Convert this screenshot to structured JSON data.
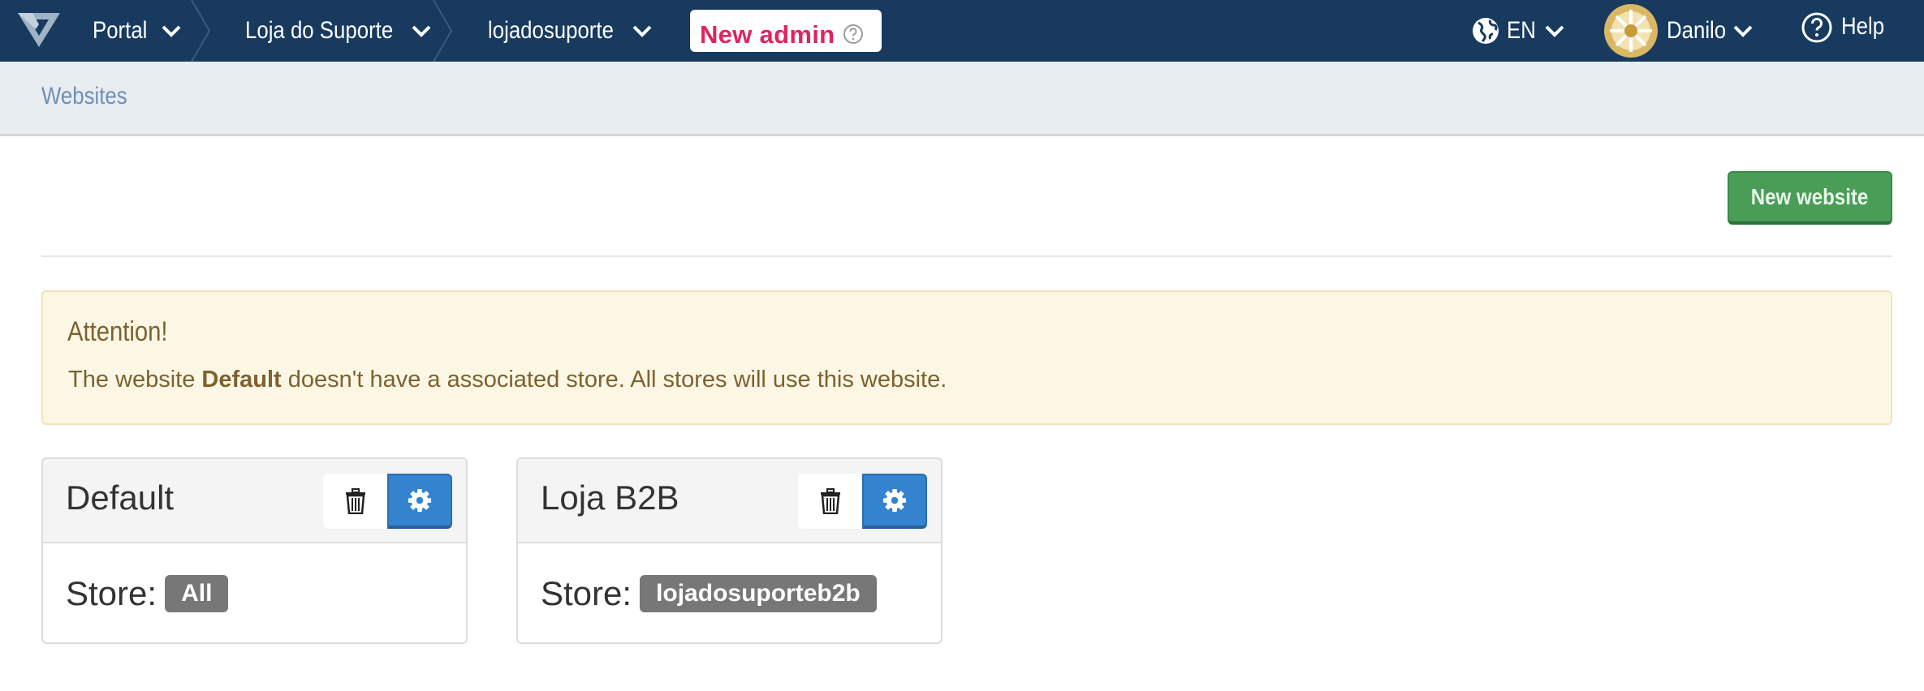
{
  "navbar": {
    "portal": "Portal",
    "store": "Loja do Suporte",
    "account": "lojadosuporte",
    "new_admin": "New admin",
    "language": "EN",
    "user": "Danilo",
    "help": "Help"
  },
  "breadcrumb": {
    "current": "Websites"
  },
  "toolbar": {
    "new_website": "New website"
  },
  "alert": {
    "title": "Attention!",
    "msg_before": "The website ",
    "msg_bold": "Default",
    "msg_after": " doesn't have a associated store. All stores will use this website."
  },
  "websites": [
    {
      "name": "Default",
      "store_label": "Store:",
      "store": "All"
    },
    {
      "name": "Loja B2B",
      "store_label": "Store:",
      "store": "lojadosuporteb2b"
    }
  ],
  "colors": {
    "navbar": "#173a5e",
    "accent_pink": "#e0245e",
    "primary_blue": "#3383cf",
    "success_green": "#4a9d57",
    "alert_bg": "#fbf7e4"
  },
  "icons": {
    "logo": "vtex-logo-icon",
    "chevron": "chevron-down-icon",
    "globe": "globe-icon",
    "help": "question-circle-icon",
    "delete": "trash-icon",
    "settings": "gear-icon"
  }
}
